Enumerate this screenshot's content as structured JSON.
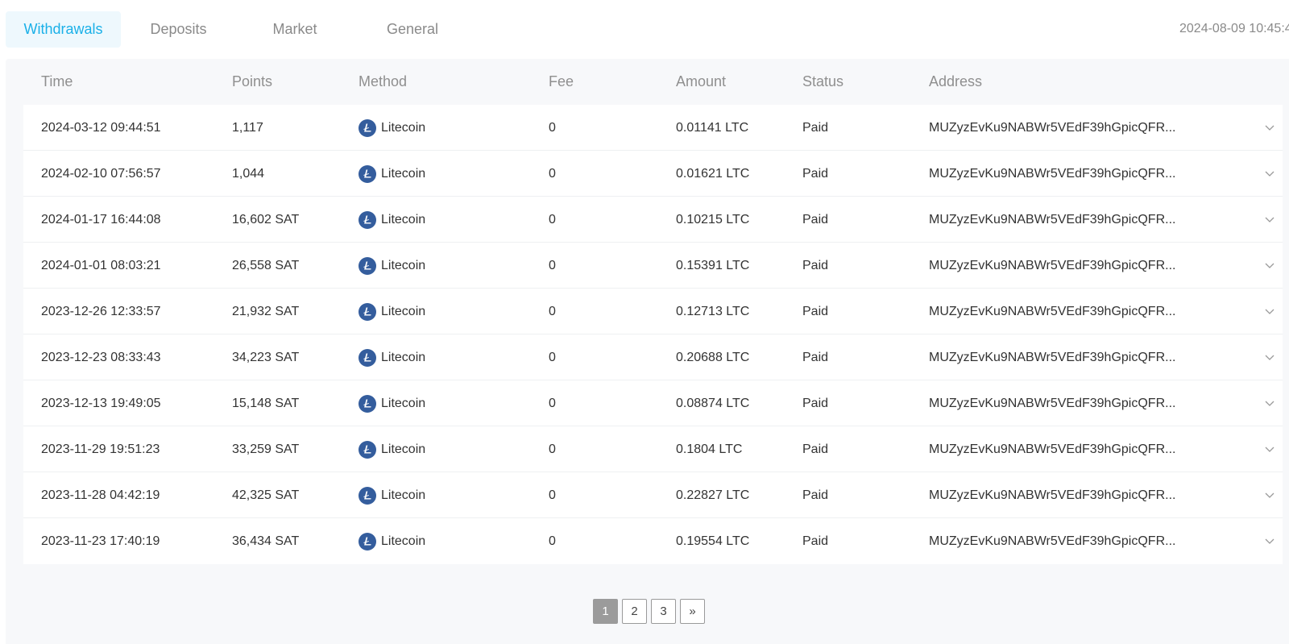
{
  "tabs": [
    {
      "label": "Withdrawals",
      "active": true
    },
    {
      "label": "Deposits",
      "active": false
    },
    {
      "label": "Market",
      "active": false
    },
    {
      "label": "General",
      "active": false
    }
  ],
  "timestamp": "2024-08-09 10:45:4",
  "table": {
    "headers": {
      "time": "Time",
      "points": "Points",
      "method": "Method",
      "fee": "Fee",
      "amount": "Amount",
      "status": "Status",
      "address": "Address"
    },
    "rows": [
      {
        "time": "2024-03-12 09:44:51",
        "points": "1,117",
        "method": "Litecoin",
        "fee": "0",
        "amount": "0.01141 LTC",
        "status": "Paid",
        "address": "MUZyzEvKu9NABWr5VEdF39hGpicQFR..."
      },
      {
        "time": "2024-02-10 07:56:57",
        "points": "1,044",
        "method": "Litecoin",
        "fee": "0",
        "amount": "0.01621 LTC",
        "status": "Paid",
        "address": "MUZyzEvKu9NABWr5VEdF39hGpicQFR..."
      },
      {
        "time": "2024-01-17 16:44:08",
        "points": "16,602 SAT",
        "method": "Litecoin",
        "fee": "0",
        "amount": "0.10215 LTC",
        "status": "Paid",
        "address": "MUZyzEvKu9NABWr5VEdF39hGpicQFR..."
      },
      {
        "time": "2024-01-01 08:03:21",
        "points": "26,558 SAT",
        "method": "Litecoin",
        "fee": "0",
        "amount": "0.15391 LTC",
        "status": "Paid",
        "address": "MUZyzEvKu9NABWr5VEdF39hGpicQFR..."
      },
      {
        "time": "2023-12-26 12:33:57",
        "points": "21,932 SAT",
        "method": "Litecoin",
        "fee": "0",
        "amount": "0.12713 LTC",
        "status": "Paid",
        "address": "MUZyzEvKu9NABWr5VEdF39hGpicQFR..."
      },
      {
        "time": "2023-12-23 08:33:43",
        "points": "34,223 SAT",
        "method": "Litecoin",
        "fee": "0",
        "amount": "0.20688 LTC",
        "status": "Paid",
        "address": "MUZyzEvKu9NABWr5VEdF39hGpicQFR..."
      },
      {
        "time": "2023-12-13 19:49:05",
        "points": "15,148 SAT",
        "method": "Litecoin",
        "fee": "0",
        "amount": "0.08874 LTC",
        "status": "Paid",
        "address": "MUZyzEvKu9NABWr5VEdF39hGpicQFR..."
      },
      {
        "time": "2023-11-29 19:51:23",
        "points": "33,259 SAT",
        "method": "Litecoin",
        "fee": "0",
        "amount": "0.1804 LTC",
        "status": "Paid",
        "address": "MUZyzEvKu9NABWr5VEdF39hGpicQFR..."
      },
      {
        "time": "2023-11-28 04:42:19",
        "points": "42,325 SAT",
        "method": "Litecoin",
        "fee": "0",
        "amount": "0.22827 LTC",
        "status": "Paid",
        "address": "MUZyzEvKu9NABWr5VEdF39hGpicQFR..."
      },
      {
        "time": "2023-11-23 17:40:19",
        "points": "36,434 SAT",
        "method": "Litecoin",
        "fee": "0",
        "amount": "0.19554 LTC",
        "status": "Paid",
        "address": "MUZyzEvKu9NABWr5VEdF39hGpicQFR..."
      }
    ],
    "method_icon": "litecoin-icon",
    "expand_icon": "chevron-down-icon"
  },
  "pagination": {
    "pages": [
      "1",
      "2",
      "3"
    ],
    "current": "1",
    "next_label": "»"
  },
  "colors": {
    "accent": "#1ab0e8",
    "active_tab_bg": "#eef8fd",
    "litecoin": "#345d9d",
    "panel_bg": "#f7f8fa",
    "active_page_bg": "#9b9b9b"
  }
}
